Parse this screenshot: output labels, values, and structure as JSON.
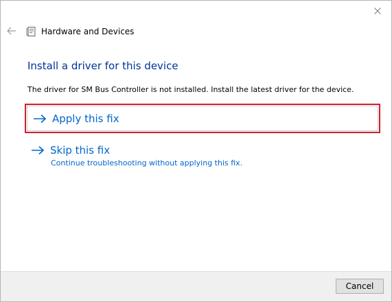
{
  "window": {
    "title": "Hardware and Devices",
    "close_icon": "close-icon",
    "back_icon": "back-arrow-icon",
    "app_icon": "troubleshooter-icon"
  },
  "content": {
    "heading": "Install a driver for this device",
    "description": "The driver for SM Bus Controller is not installed. Install the latest driver for the device."
  },
  "options": {
    "apply": {
      "label": "Apply this fix",
      "icon": "arrow-right-icon"
    },
    "skip": {
      "label": "Skip this fix",
      "sublabel": "Continue troubleshooting without applying this fix.",
      "icon": "arrow-right-icon"
    }
  },
  "footer": {
    "cancel_label": "Cancel"
  },
  "colors": {
    "heading": "#003399",
    "link": "#0066cc",
    "highlight_border": "#cc1f2e",
    "footer_bg": "#f0f0f0"
  }
}
